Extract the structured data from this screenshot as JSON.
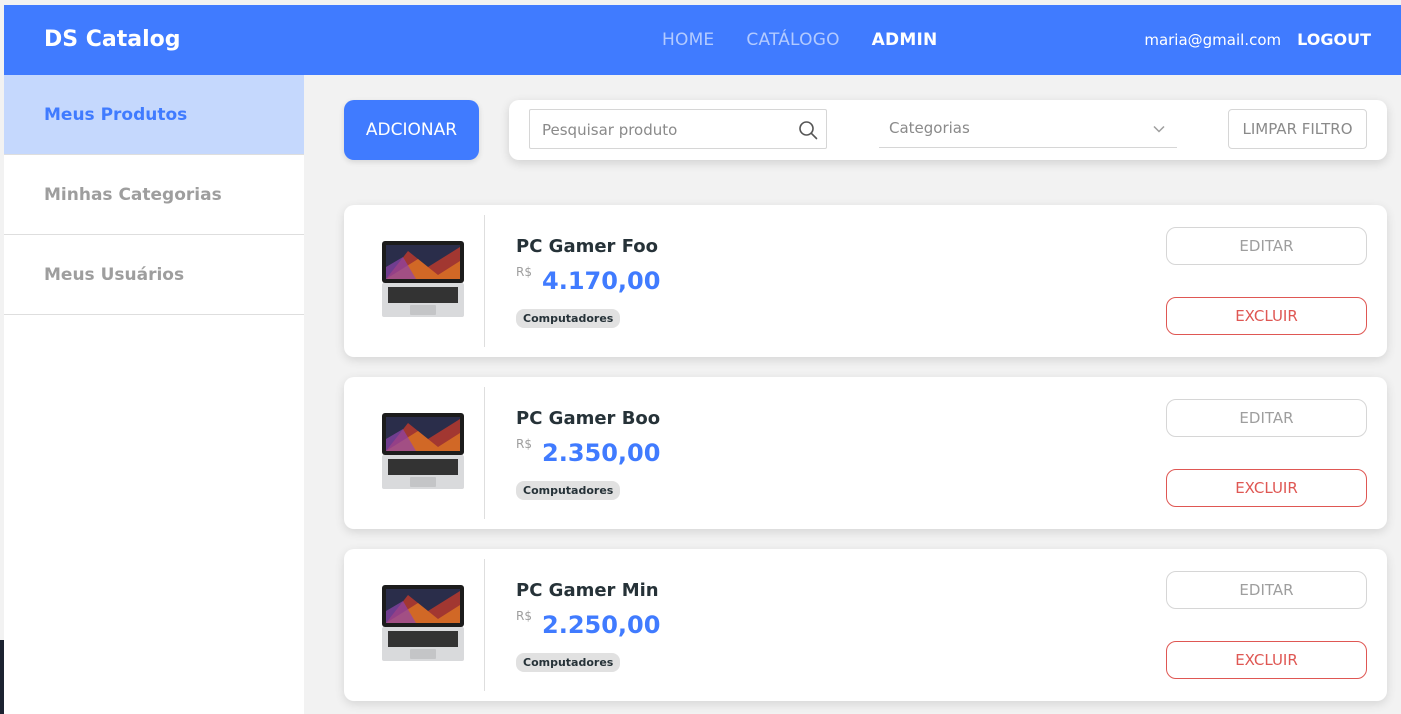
{
  "header": {
    "brand": "DS Catalog",
    "nav": [
      {
        "label": "HOME",
        "active": false
      },
      {
        "label": "CATÁLOGO",
        "active": false
      },
      {
        "label": "ADMIN",
        "active": true
      }
    ],
    "user_email": "maria@gmail.com",
    "logout_label": "LOGOUT"
  },
  "sidebar": {
    "items": [
      {
        "label": "Meus Produtos",
        "active": true
      },
      {
        "label": "Minhas Categorias",
        "active": false
      },
      {
        "label": "Meus Usuários",
        "active": false
      }
    ]
  },
  "toolbar": {
    "add_label": "ADCIONAR",
    "search_placeholder": "Pesquisar produto",
    "category_placeholder": "Categorias",
    "clear_label": "LIMPAR FILTRO"
  },
  "products": [
    {
      "name": "PC Gamer Foo",
      "currency": "R$",
      "price": "4.170,00",
      "category": "Computadores",
      "edit_label": "EDITAR",
      "delete_label": "EXCLUIR"
    },
    {
      "name": "PC Gamer Boo",
      "currency": "R$",
      "price": "2.350,00",
      "category": "Computadores",
      "edit_label": "EDITAR",
      "delete_label": "EXCLUIR"
    },
    {
      "name": "PC Gamer Min",
      "currency": "R$",
      "price": "2.250,00",
      "category": "Computadores",
      "edit_label": "EDITAR",
      "delete_label": "EXCLUIR"
    }
  ],
  "colors": {
    "primary": "#407bff",
    "danger": "#df5753",
    "sidebar_active_bg": "#c5d8fd"
  }
}
